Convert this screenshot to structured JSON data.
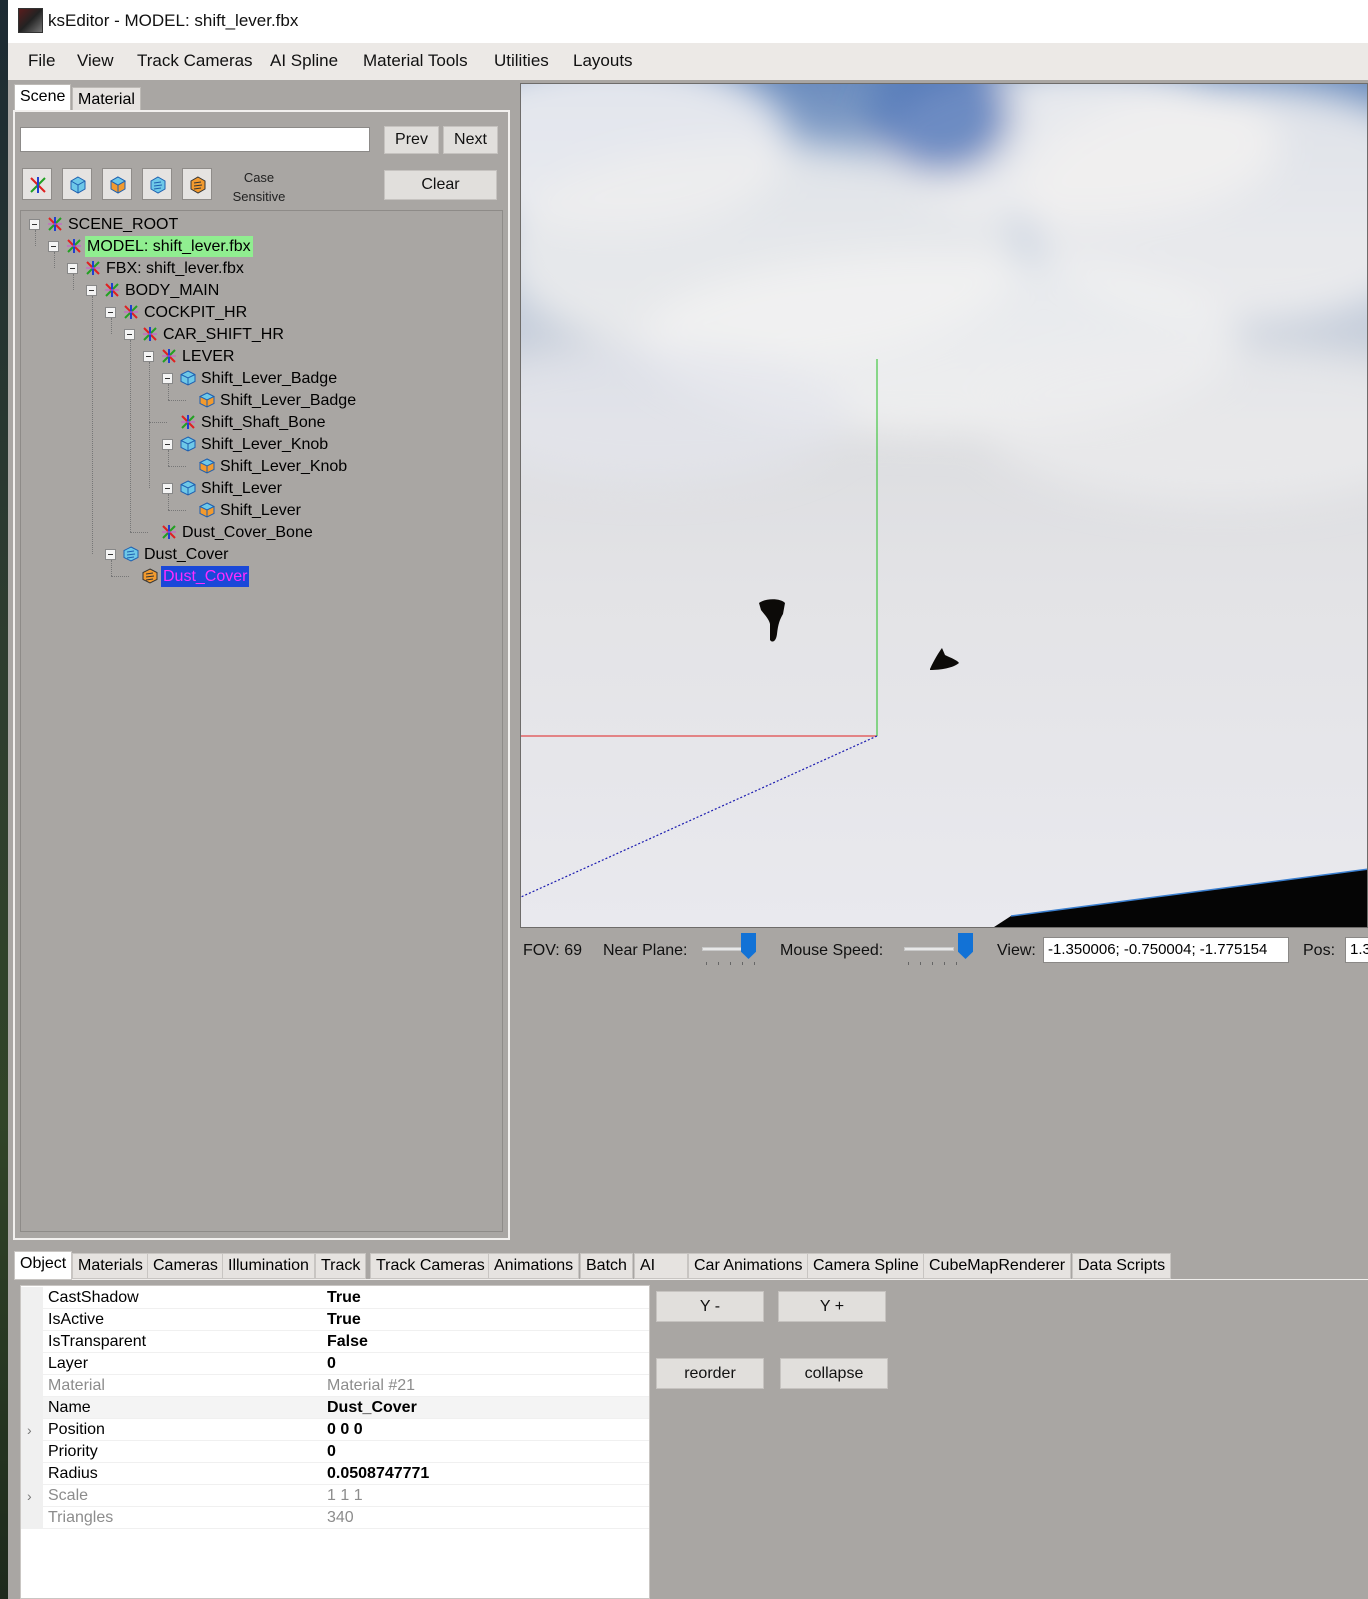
{
  "window": {
    "title": "ksEditor - MODEL: shift_lever.fbx"
  },
  "menu": [
    "File",
    "View",
    "Track Cameras",
    "AI Spline",
    "Material Tools",
    "Utilities",
    "Layouts"
  ],
  "left_tabs": [
    "Scene",
    "Material"
  ],
  "search": {
    "value": "",
    "prev_label": "Prev",
    "next_label": "Next",
    "clear_label": "Clear",
    "case_label": "Case Sensitive"
  },
  "tree": [
    {
      "label": "SCENE_ROOT",
      "icon": "node-icon",
      "toggle": true
    },
    {
      "label": "MODEL: shift_lever.fbx",
      "icon": "node-icon",
      "toggle": true,
      "highlight": "green"
    },
    {
      "label": "FBX: shift_lever.fbx",
      "icon": "node-icon",
      "toggle": true
    },
    {
      "label": "BODY_MAIN",
      "icon": "node-icon",
      "toggle": true
    },
    {
      "label": "COCKPIT_HR",
      "icon": "node-icon",
      "toggle": true
    },
    {
      "label": "CAR_SHIFT_HR",
      "icon": "node-icon",
      "toggle": true
    },
    {
      "label": "LEVER",
      "icon": "node-icon",
      "toggle": true
    },
    {
      "label": "Shift_Lever_Badge",
      "icon": "mesh-group-icon",
      "toggle": true
    },
    {
      "label": "Shift_Lever_Badge",
      "icon": "mesh-icon",
      "toggle": false
    },
    {
      "label": "Shift_Shaft_Bone",
      "icon": "node-icon",
      "toggle": false
    },
    {
      "label": "Shift_Lever_Knob",
      "icon": "mesh-group-icon",
      "toggle": true
    },
    {
      "label": "Shift_Lever_Knob",
      "icon": "mesh-icon",
      "toggle": false
    },
    {
      "label": "Shift_Lever",
      "icon": "mesh-group-icon",
      "toggle": true
    },
    {
      "label": "Shift_Lever",
      "icon": "mesh-icon",
      "toggle": false
    },
    {
      "label": "Dust_Cover_Bone",
      "icon": "node-icon",
      "toggle": false
    },
    {
      "label": "Dust_Cover",
      "icon": "skinned-group-icon",
      "toggle": true
    },
    {
      "label": "Dust_Cover",
      "icon": "skinned-mesh-icon",
      "toggle": false,
      "highlight": "selected"
    }
  ],
  "viewport_controls": {
    "fov": "FOV: 69",
    "near_plane_label": "Near Plane:",
    "mouse_speed_label": "Mouse Speed:",
    "view_label": "View:",
    "view_value": "-1.350006; -0.750004; -1.775154",
    "pos_label": "Pos:",
    "pos_value": "1.3"
  },
  "bottom_tabs": [
    "Object",
    "Materials",
    "Cameras",
    "Illumination",
    "Track",
    "Track Cameras",
    "Animations",
    "Batch",
    "AI",
    "Car Animations",
    "Camera Spline",
    "CubeMapRenderer",
    "Data Scripts"
  ],
  "properties": [
    {
      "name": "CastShadow",
      "value": "True",
      "readonly": false,
      "expandable": false
    },
    {
      "name": "IsActive",
      "value": "True",
      "readonly": false,
      "expandable": false
    },
    {
      "name": "IsTransparent",
      "value": "False",
      "readonly": false,
      "expandable": false
    },
    {
      "name": "Layer",
      "value": "0",
      "readonly": false,
      "expandable": false
    },
    {
      "name": "Material",
      "value": "Material #21",
      "readonly": true,
      "expandable": false
    },
    {
      "name": "Name",
      "value": "Dust_Cover",
      "readonly": false,
      "expandable": false
    },
    {
      "name": "Position",
      "value": "0 0 0",
      "readonly": false,
      "expandable": true
    },
    {
      "name": "Priority",
      "value": "0",
      "readonly": false,
      "expandable": false
    },
    {
      "name": "Radius",
      "value": "0.0508747771",
      "readonly": false,
      "expandable": false
    },
    {
      "name": "Scale",
      "value": "1 1 1",
      "readonly": true,
      "expandable": true
    },
    {
      "name": "Triangles",
      "value": "340",
      "readonly": true,
      "expandable": false
    }
  ],
  "actions": {
    "y_minus": "Y -",
    "y_plus": "Y +",
    "reorder": "reorder",
    "collapse": "collapse"
  },
  "colors": {
    "selection_bg": "#1a48d8",
    "selection_text": "#ff2bff",
    "model_highlight": "#90ee90",
    "axis_x": "#e02020",
    "axis_y": "#22c022",
    "axis_z": "#1a1ab0",
    "slider_thumb": "#1272d6"
  }
}
